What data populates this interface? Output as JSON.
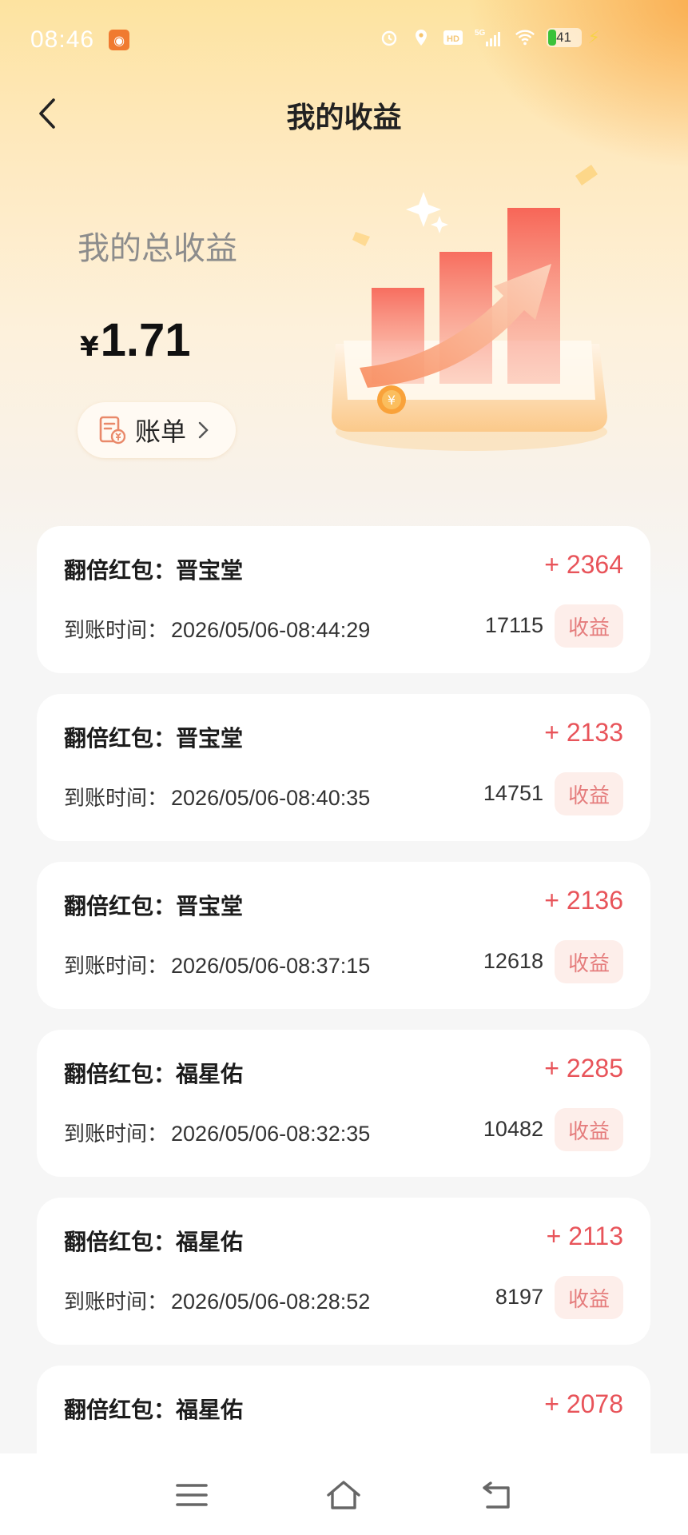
{
  "status_bar": {
    "time": "08:46",
    "battery": "41",
    "network": "5G"
  },
  "header": {
    "title": "我的收益"
  },
  "summary": {
    "label": "我的总收益",
    "currency": "¥",
    "amount": "1.71",
    "bill_label": "账单"
  },
  "records": [
    {
      "title": "翻倍红包：晋宝堂",
      "amount": "+ 2364",
      "time_label": "到账时间：",
      "time": "2026/05/06-08:44:29",
      "count": "17115",
      "tag": "收益"
    },
    {
      "title": "翻倍红包：晋宝堂",
      "amount": "+ 2133",
      "time_label": "到账时间：",
      "time": "2026/05/06-08:40:35",
      "count": "14751",
      "tag": "收益"
    },
    {
      "title": "翻倍红包：晋宝堂",
      "amount": "+ 2136",
      "time_label": "到账时间：",
      "time": "2026/05/06-08:37:15",
      "count": "12618",
      "tag": "收益"
    },
    {
      "title": "翻倍红包：福星佑",
      "amount": "+ 2285",
      "time_label": "到账时间：",
      "time": "2026/05/06-08:32:35",
      "count": "10482",
      "tag": "收益"
    },
    {
      "title": "翻倍红包：福星佑",
      "amount": "+ 2113",
      "time_label": "到账时间：",
      "time": "2026/05/06-08:28:52",
      "count": "8197",
      "tag": "收益"
    },
    {
      "title": "翻倍红包：福星佑",
      "amount": "+ 2078",
      "time_label": "",
      "time": "",
      "count": "",
      "tag": ""
    }
  ],
  "icons": {
    "back": "back-arrow-icon",
    "bill": "receipt-yuan-icon",
    "menu": "menu-icon",
    "home": "home-icon",
    "return": "return-icon"
  },
  "colors": {
    "accent": "#e8545a",
    "tag_bg": "#fdeeea",
    "hero_top": "#fde3a0"
  }
}
